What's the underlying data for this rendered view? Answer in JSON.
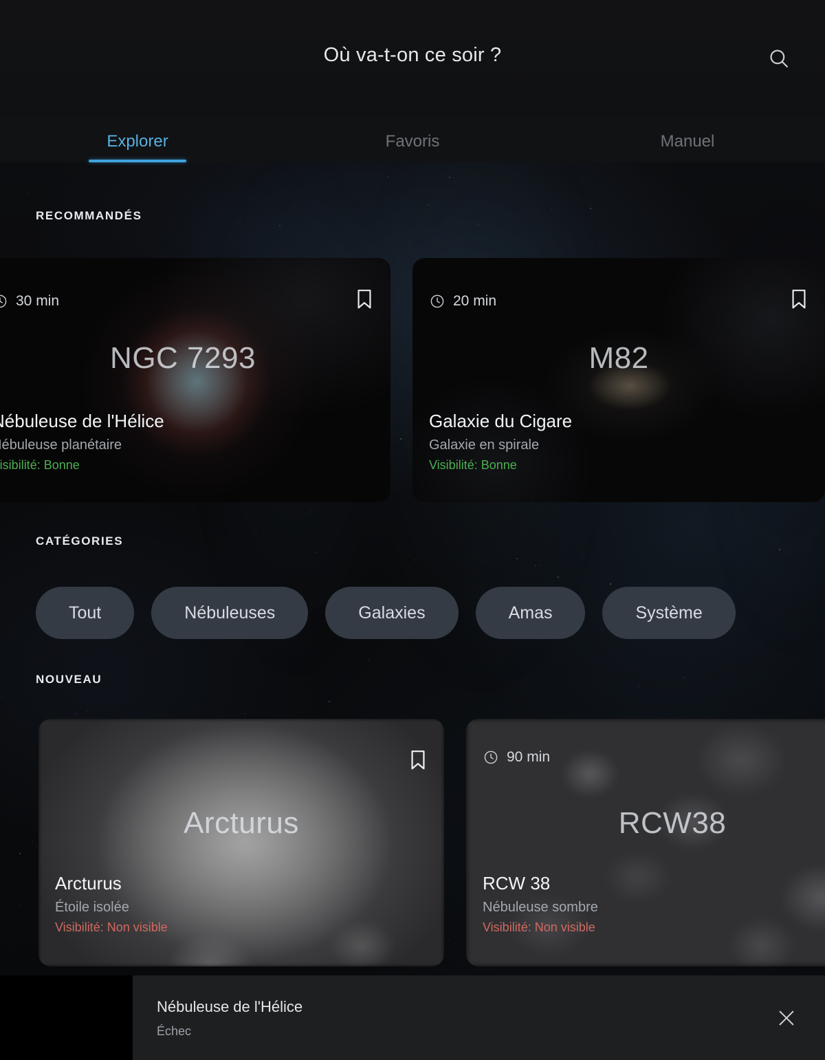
{
  "header": {
    "title": "Où va-t-on ce soir ?",
    "search_icon": "search-icon"
  },
  "tabs": [
    {
      "label": "Explorer",
      "active": true
    },
    {
      "label": "Favoris",
      "active": false
    },
    {
      "label": "Manuel",
      "active": false
    }
  ],
  "sections": {
    "recommended_label": "RECOMMANDÉS",
    "categories_label": "CATÉGORIES",
    "new_label": "NOUVEAU"
  },
  "recommended": [
    {
      "duration": "30 min",
      "overlay_name": "NGC 7293",
      "title": "Nébuleuse de l'Hélice",
      "subtitle": "Nébuleuse planétaire",
      "visibility": "Visibilité: Bonne",
      "visibility_state": "good",
      "bookmark_icon": "bookmark-icon",
      "clock_icon": "clock-icon"
    },
    {
      "duration": "20 min",
      "overlay_name": "M82",
      "title": "Galaxie du Cigare",
      "subtitle": "Galaxie en spirale",
      "visibility": "Visibilité: Bonne",
      "visibility_state": "good",
      "bookmark_icon": "bookmark-icon",
      "clock_icon": "clock-icon"
    }
  ],
  "categories": [
    {
      "label": "Tout"
    },
    {
      "label": "Nébuleuses"
    },
    {
      "label": "Galaxies"
    },
    {
      "label": "Amas"
    },
    {
      "label": "Système"
    }
  ],
  "new_items": [
    {
      "duration": "",
      "overlay_name": "Arcturus",
      "title": "Arcturus",
      "subtitle": "Étoile isolée",
      "visibility": "Visibilité: Non visible",
      "visibility_state": "bad",
      "bookmark_icon": "bookmark-icon"
    },
    {
      "duration": "90 min",
      "overlay_name": "RCW38",
      "title": "RCW 38",
      "subtitle": "Nébuleuse sombre",
      "visibility": "Visibilité: Non visible",
      "visibility_state": "bad",
      "clock_icon": "clock-icon"
    }
  ],
  "bottom_bar": {
    "title": "Nébuleuse de l'Hélice",
    "status": "Échec",
    "close_icon": "close-icon"
  },
  "colors": {
    "accent": "#3FA3DD",
    "accent_text": "#58B0E0",
    "visibility_good": "#4CAF50",
    "visibility_bad": "#D2695F",
    "pill_bg": "#343B45",
    "background": "#0B0C0E",
    "bottom_bar_bg": "#1E1F21"
  }
}
